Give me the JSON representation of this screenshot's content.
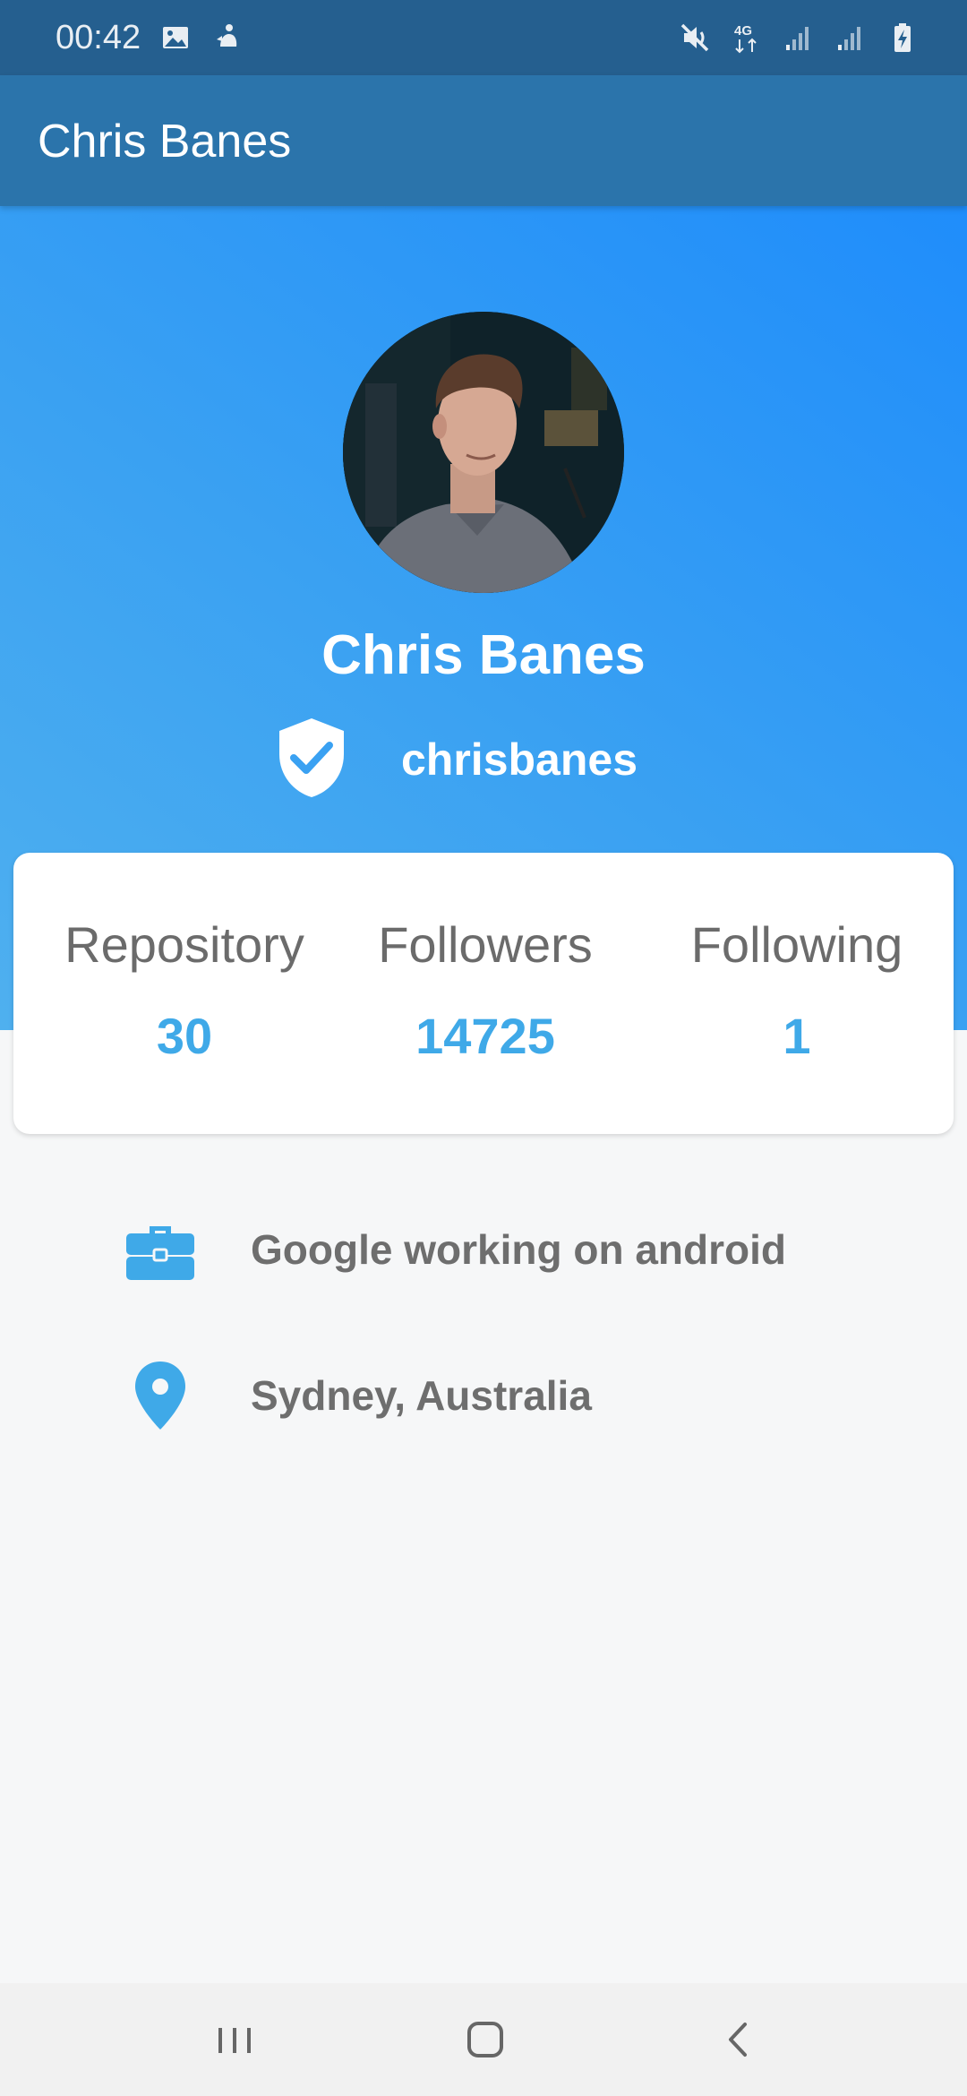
{
  "status_bar": {
    "time": "00:42",
    "left_icons": [
      "gallery-icon",
      "notification-icon"
    ],
    "right_icons": [
      "mute-icon",
      "4g-data-icon",
      "signal-icon",
      "signal-icon",
      "battery-charging-icon"
    ],
    "network_label": "4G"
  },
  "app_bar": {
    "title": "Chris Banes"
  },
  "profile": {
    "name": "Chris Banes",
    "handle": "chrisbanes",
    "verified_icon": "shield-check-icon",
    "gradient_colors": [
      "#4fb0ef",
      "#1f8dfb"
    ]
  },
  "stats": [
    {
      "label": "Repository",
      "value": "30"
    },
    {
      "label": "Followers",
      "value": "14725"
    },
    {
      "label": "Following",
      "value": "1"
    }
  ],
  "info": {
    "company": {
      "icon": "briefcase-icon",
      "text": "Google working on android"
    },
    "location": {
      "icon": "location-pin-icon",
      "text": "Sydney, Australia"
    }
  },
  "colors": {
    "status_bar": "#255f8f",
    "app_bar": "#2b74ab",
    "accent": "#3fa9e8",
    "text_muted": "#6e6e6e",
    "background": "#f6f7f8"
  },
  "nav_bar": {
    "buttons": [
      "recent-apps-icon",
      "home-icon",
      "back-icon"
    ]
  }
}
